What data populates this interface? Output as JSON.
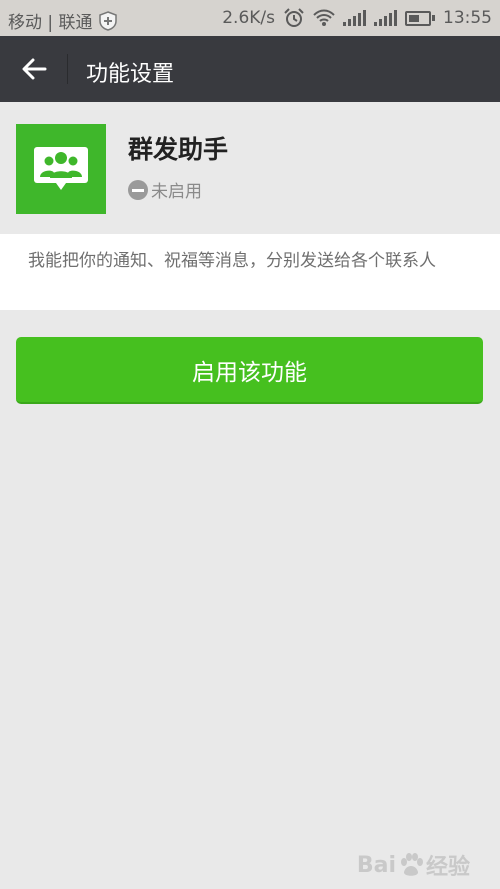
{
  "status_bar": {
    "carrier": "移动 | 联通",
    "net_speed": "2.6K/s",
    "time": "13:55",
    "icons": [
      "shield-icon",
      "alarm-icon",
      "wifi-icon",
      "signal-icon",
      "signal-icon",
      "battery-icon"
    ]
  },
  "top_bar": {
    "back_icon": "arrow-left-icon",
    "title": "功能设置"
  },
  "plugin": {
    "name": "群发助手",
    "status": "未启用",
    "icon": "group-chat-icon",
    "icon_color": "#3fb72b"
  },
  "description": "我能把你的通知、祝福等消息，分别发送给各个联系人",
  "actions": {
    "enable_label": "启用该功能",
    "enable_color": "#46c01f"
  },
  "watermark": {
    "text_left": "Bai",
    "text_right": "经验"
  }
}
